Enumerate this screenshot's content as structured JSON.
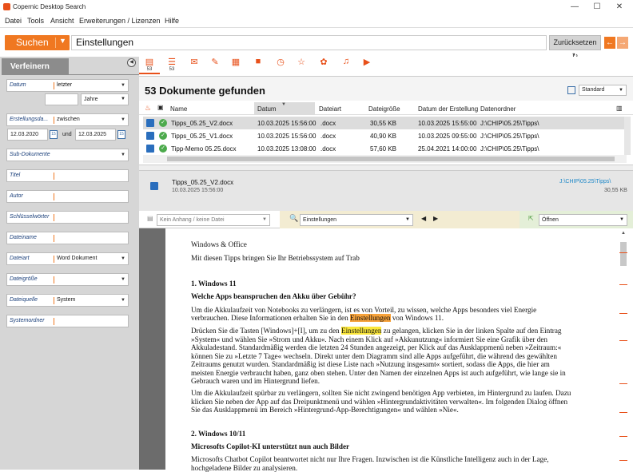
{
  "window": {
    "title": "Copernic Desktop Search",
    "minimize": "—",
    "maximize": "☐",
    "close": "✕"
  },
  "menu": [
    "Datei",
    "Tools",
    "Ansicht",
    "Erweiterungen / Lizenzen",
    "Hilfe"
  ],
  "search": {
    "button_label": "Suchen",
    "query": "Einstellungen",
    "reset_label": "Zurücksetzen ↻"
  },
  "sidebar": {
    "header": "Verfeinern",
    "datum": {
      "label": "Datum",
      "value": "letzter",
      "unit": "Jahre"
    },
    "erstellung": {
      "label": "Erstellungsda...",
      "value": "zwischen",
      "from": "12.03.2020",
      "and": "und",
      "to": "12.03.2025"
    },
    "fields": [
      {
        "label": "Sub-Dokumente",
        "value": ""
      },
      {
        "label": "Titel",
        "value": ""
      },
      {
        "label": "Autor",
        "value": ""
      },
      {
        "label": "Schlüsselwörter",
        "value": ""
      },
      {
        "label": "Dateiname",
        "value": ""
      },
      {
        "label": "Dateiart",
        "value": "Word Dokument"
      },
      {
        "label": "Dateigröße",
        "value": ""
      },
      {
        "label": "Dateiquelle",
        "value": "System"
      },
      {
        "label": "Systemordner",
        "value": ""
      }
    ]
  },
  "tabs": [
    {
      "count": "53"
    },
    {
      "count": "53"
    }
  ],
  "results": {
    "title": "53 Dokumente gefunden",
    "view": "Standard",
    "columns": [
      "Name",
      "Datum",
      "Dateiart",
      "Dateigröße",
      "Datum der Erstellung",
      "Datenordner"
    ],
    "rows": [
      {
        "name": "Tipps_05.25_V2.docx",
        "date": "10.03.2025 15:56:00",
        "type": ".docx",
        "size": "30,55 KB",
        "created": "10.03.2025 15:55:00",
        "folder": "J:\\CHIP\\05.25\\Tipps\\"
      },
      {
        "name": "Tipps_05.25_V1.docx",
        "date": "10.03.2025 15:56:00",
        "type": ".docx",
        "size": "40,90 KB",
        "created": "10.03.2025 09:55:00",
        "folder": "J:\\CHIP\\05.25\\Tipps\\"
      },
      {
        "name": "Tipp-Memo 05.25.docx",
        "date": "10.03.2025 13:08:00",
        "type": ".docx",
        "size": "57,60 KB",
        "created": "25.04.2021 14:00:00",
        "folder": "J:\\CHIP\\05.25\\Tipps\\"
      }
    ]
  },
  "preview": {
    "name": "Tipps_05.25_V2.docx",
    "date": "10.03.2025 15:56:00",
    "folder": "J:\\CHIP\\05.25\\Tipps\\",
    "size": "30,55 KB"
  },
  "docbar": {
    "attachment": "Kein Anhang / keine Datei",
    "find": "Einstellungen",
    "open": "Öffnen"
  },
  "doc": {
    "l1": "Windows & Office",
    "l2": "Mit diesen Tipps bringen Sie Ihr Betriebssystem auf Trab",
    "h1": "1. Windows 11",
    "h1b": "Welche Apps beanspruchen den Akku über Gebühr?",
    "p1a": "Um die Akkulaufzeit von Notebooks zu verlängern, ist es von Vorteil, zu wissen, welche Apps besonders viel Energie",
    "p1b_pre": "verbrauchen. Diese Informationen erhalten Sie in den ",
    "p1b_hl": "Einstellungen",
    "p1b_post": " von Windows 11.",
    "p2a_pre": "Drücken Sie die Tasten [Windows]+[I], um zu den ",
    "p2a_hl": "Einstellungen",
    "p2a_post": " zu gelangen, klicken Sie in der linken Spalte auf den Eintrag",
    "p2b": "»System« und wählen Sie »Strom und Akku«. Nach einem Klick auf »Akkunutzung« informiert Sie eine Grafik über den",
    "p2c": "Akkuladestand. Standardmäßig werden die letzten 24 Stunden angezeigt, per Klick auf das Ausklappmenü neben »Zeitraum:«",
    "p2d": "können Sie zu »Letzte 7 Tage« wechseln. Direkt unter dem Diagramm sind alle Apps aufgeführt, die während des gewählten",
    "p2e": "Zeitraums genutzt wurden. Standardmäßig ist diese Liste nach »Nutzung insgesamt« sortiert, sodass die Apps, die hier am",
    "p2f": "meisten Energie verbraucht haben, ganz oben stehen. Unter den Namen der einzelnen Apps ist auch aufgeführt, wie lange sie in",
    "p2g": "Gebrauch waren und im Hintergrund liefen.",
    "p3a": "Um die Akkulaufzeit spürbar zu verlängern, sollten Sie nicht zwingend benötigen App verbieten, im Hintergrund zu laufen. Dazu",
    "p3b": "klicken Sie neben der App auf das Dreipunktmenü und wählen »Hintergrundaktivitäten verwalten«. Im folgenden Dialog öffnen",
    "p3c": "Sie das Ausklappmenü im Bereich »Hintergrund-App-Berechtigungen« und wählen »Nie«.",
    "h2": "2. Windows 10/11",
    "h2b": "Microsofts Copilot-KI unterstützt nun auch Bilder",
    "p4a": "Microsofts Chatbot Copilot beantwortet nicht nur Ihre Fragen. Inzwischen ist die Künstliche Intelligenz auch in der Lage,",
    "p4b": "hochgeladene Bilder zu analysieren."
  },
  "colors": {
    "accent": "#f07821",
    "highlight_current": "#f7a23a",
    "highlight": "#fbe73a"
  }
}
